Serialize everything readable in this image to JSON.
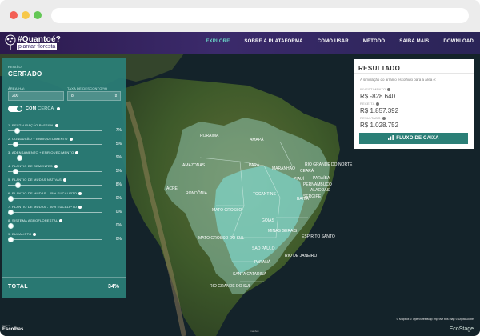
{
  "nav": {
    "brand_top": "#Quantoé?",
    "brand_bottom": "plantar floresta",
    "items": [
      {
        "label": "EXPLORE",
        "active": true
      },
      {
        "label": "SOBRE A PLATAFORMA",
        "active": false
      },
      {
        "label": "COMO USAR",
        "active": false
      },
      {
        "label": "MÉTODO",
        "active": false
      },
      {
        "label": "SAIBA MAIS",
        "active": false
      },
      {
        "label": "DOWNLOAD",
        "active": false
      }
    ]
  },
  "panel": {
    "region_label": "REGIÃO",
    "region": "CERRADO",
    "area_label": "ÁREA(HA)",
    "area_value": "200",
    "discount_label": "TAXA DE DESCONTO(%)",
    "discount_value": "8",
    "toggle_label": "COM",
    "toggle_sub": "CERCA",
    "rows": [
      {
        "label": "1. RESTAURAÇÃO PASSIVA",
        "value": "7%",
        "level": 0.07
      },
      {
        "label": "2. CONDUÇÃO + ENRIQUECIMENTO",
        "value": "5%",
        "level": 0.05
      },
      {
        "label": "3. ADENSAMENTO + ENRIQUECIMENTO",
        "value": "9%",
        "level": 0.09
      },
      {
        "label": "4. PLANTIO DE SEMENTES",
        "value": "5%",
        "level": 0.05
      },
      {
        "label": "5. PLANTIO DE MUDAS NATIVAS",
        "value": "8%",
        "level": 0.08
      },
      {
        "label": "6. PLANTIO DE MUDAS - 25% EUCALIPTO",
        "value": "0%",
        "level": 0
      },
      {
        "label": "7. PLANTIO DE MUDAS - 50% EUCALIPTO",
        "value": "0%",
        "level": 0
      },
      {
        "label": "8. SISTEMA AGROFLORESTAL",
        "value": "0%",
        "level": 0
      },
      {
        "label": "9. EUCALIPTO",
        "value": "0%",
        "level": 0
      }
    ],
    "total_label": "TOTAL",
    "total_value": "34%"
  },
  "result": {
    "title": "RESULTADO",
    "subtitle": "A simulação do arranjo escolhido para a área é:",
    "invest_label": "INVESTIMENTO",
    "invest_value": "R$ -828.640",
    "receita_label": "RECEITA",
    "receita_value": "R$ 1.857.392",
    "resultado_label": "RESULTADO",
    "resultado_value": "R$ 1.028.752",
    "button_label": "FLUXO DE CAIXA"
  },
  "map": {
    "states": [
      "RORAIMA",
      "AMAPÁ",
      "AMAZONAS",
      "PARÁ",
      "MARANHÃO",
      "CEARÁ",
      "RIO GRANDE DO NORTE",
      "PARAÍBA",
      "PERNAMBUCO",
      "ACRE",
      "RONDÔNIA",
      "PIAUÍ",
      "ALAGOAS",
      "TOCANTINS",
      "SERGIPE",
      "BAHIA",
      "MATO GROSSO",
      "GOIÁS",
      "MINAS GERAIS",
      "MATO GROSSO DO SUL",
      "ESPÍRITO SANTO",
      "SÃO PAULO",
      "RIO DE JANEIRO",
      "PARANÁ",
      "SANTA CATARINA",
      "RIO GRANDE DO SUL"
    ],
    "attribution": "© Mapbox © OpenStreetMap Improve this map © DigitalGlobe",
    "footer_logo_pre": "instituto",
    "footer_logo": "Escolhas",
    "footer_eco": "EcoStage",
    "mapbox_mark": "mapbox"
  },
  "colors": {
    "panel": "#2b7f77",
    "nav": "#3b2a6b",
    "accent": "#6ad3c7",
    "cerrado": "#7fd6cb"
  }
}
